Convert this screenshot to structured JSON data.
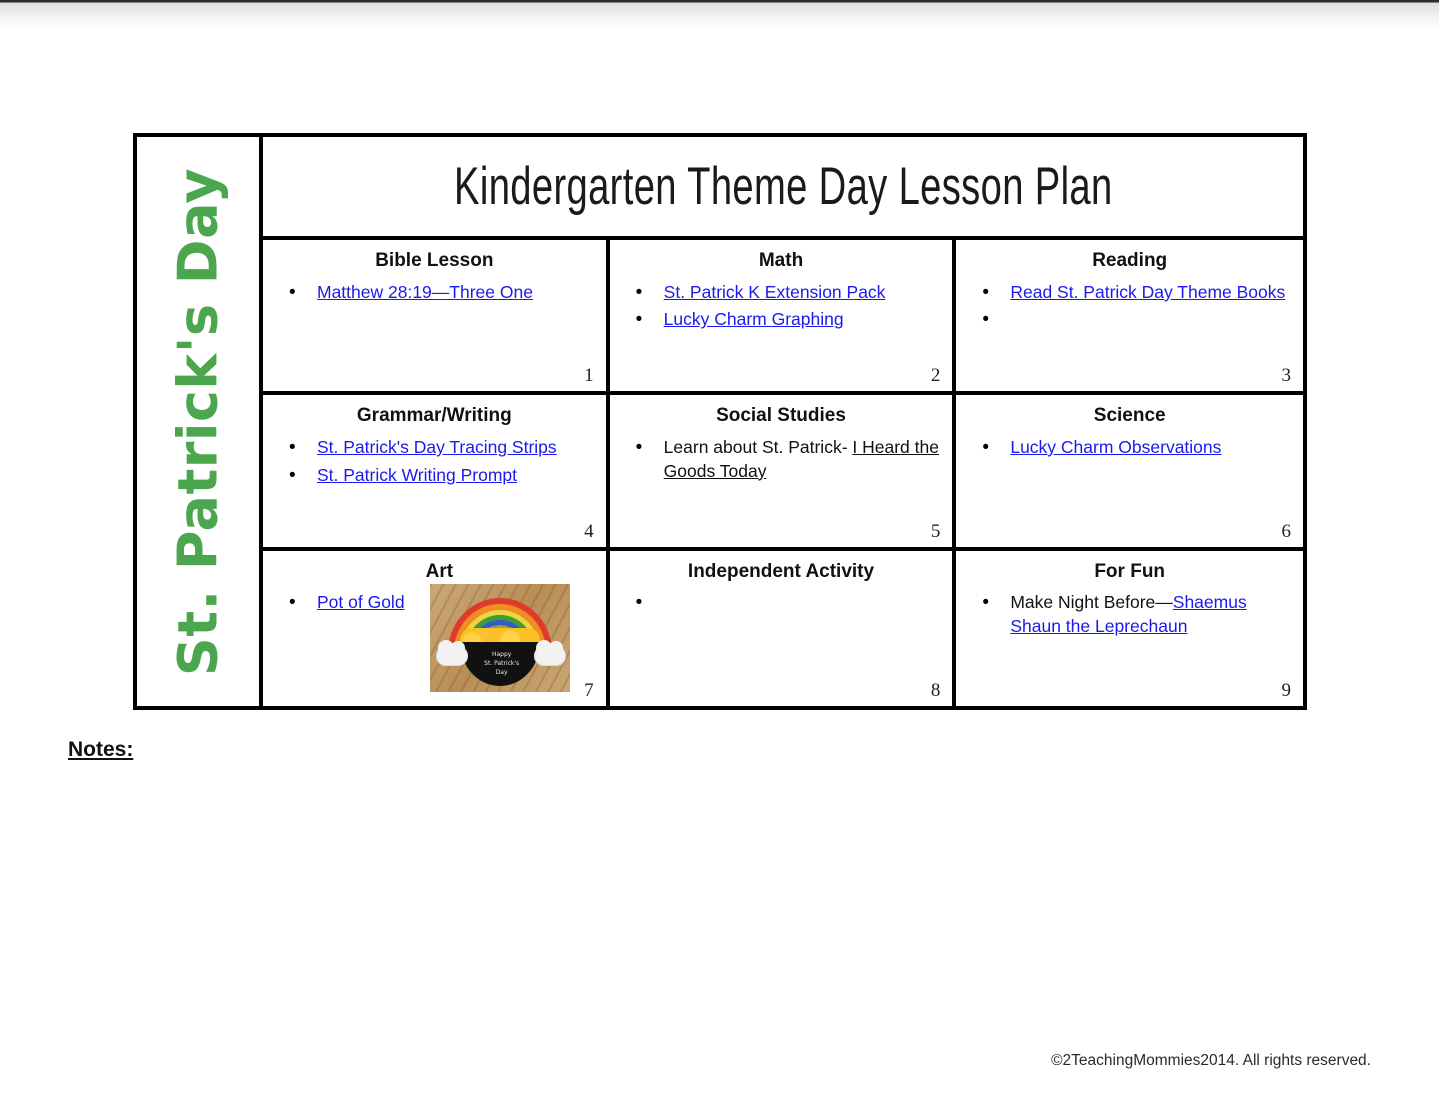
{
  "document": {
    "vertical_title": "St. Patrick's Day",
    "main_title": "Kindergarten Theme Day Lesson Plan",
    "notes_label": "Notes:",
    "footer": "©2TeachingMommies2014. All rights reserved.",
    "accent_green": "#4ca64e",
    "link_blue": "#1a1aee",
    "border_color": "#000000"
  },
  "cells": [
    {
      "number": "1",
      "title": "Bible Lesson",
      "items": [
        {
          "parts": [
            {
              "text": "Matthew 28:19—Three One",
              "style": "link"
            }
          ]
        }
      ]
    },
    {
      "number": "2",
      "title": "Math",
      "items": [
        {
          "parts": [
            {
              "text": "St. Patrick K Extension Pack",
              "style": "link"
            }
          ]
        },
        {
          "parts": [
            {
              "text": "Lucky Charm Graphing",
              "style": "link"
            }
          ]
        }
      ]
    },
    {
      "number": "3",
      "title": "Reading",
      "items": [
        {
          "parts": [
            {
              "text": "Read St. Patrick Day Theme Books",
              "style": "link"
            }
          ]
        },
        {
          "parts": [
            {
              "text": "",
              "style": "plain"
            }
          ]
        }
      ]
    },
    {
      "number": "4",
      "title": "Grammar/Writing",
      "items": [
        {
          "parts": [
            {
              "text": "St. Patrick's Day Tracing Strips",
              "style": "link"
            }
          ]
        },
        {
          "parts": [
            {
              "text": "St. Patrick Writing Prompt",
              "style": "link"
            }
          ]
        }
      ]
    },
    {
      "number": "5",
      "title": "Social Studies",
      "items": [
        {
          "parts": [
            {
              "text": "Learn about St. Patrick- ",
              "style": "plain"
            },
            {
              "text": "I Heard the Goods Today",
              "style": "underline-black"
            }
          ]
        }
      ]
    },
    {
      "number": "6",
      "title": "Science",
      "items": [
        {
          "parts": [
            {
              "text": "Lucky Charm Observations",
              "style": "link"
            }
          ]
        }
      ]
    },
    {
      "number": "7",
      "title": "Art",
      "items": [
        {
          "parts": [
            {
              "text": "Pot of Gold",
              "style": "link"
            }
          ]
        }
      ],
      "image": {
        "name": "pot-of-gold-craft-photo",
        "caption": "Happy St. Patrick's Day"
      }
    },
    {
      "number": "8",
      "title": "Independent Activity",
      "items": [
        {
          "parts": [
            {
              "text": "",
              "style": "plain"
            }
          ]
        }
      ]
    },
    {
      "number": "9",
      "title": "For Fun",
      "items": [
        {
          "parts": [
            {
              "text": "Make Night Before—",
              "style": "plain"
            },
            {
              "text": "Shaemus Shaun the Leprechaun",
              "style": "link"
            }
          ]
        }
      ]
    }
  ],
  "art_image_text": {
    "line1": "Happy",
    "line2": "St. Patrick's",
    "line3": "Day"
  }
}
